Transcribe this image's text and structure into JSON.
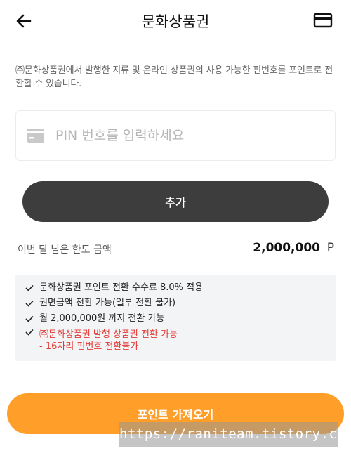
{
  "header": {
    "title": "문화상품권",
    "back_icon": "arrow-left-icon",
    "card_icon": "credit-card-icon"
  },
  "description": "㈜문화상품권에서 발행한 지류 및 온라인 상품권의 사용 가능한 핀번호를 포인트로 전환할 수 있습니다.",
  "pin_input": {
    "value": "",
    "placeholder": "PIN 번호를 입력하세요",
    "icon": "credit-card-icon"
  },
  "add_button": {
    "label": "추가"
  },
  "limit": {
    "label": "이번 달 남은 한도 금액",
    "value": "2,000,000",
    "unit": "P"
  },
  "notices": [
    "문화상품권 포인트 전환 수수료 8.0% 적용",
    "권면금액 전환 가능(일부 전환 불가)",
    "월 2,000,000원 까지 전환 가능"
  ],
  "notice_red": {
    "line1": "㈜문화상품권 발행 상품권 전환 가능",
    "line2": "- 16자리 핀번호 전환불가"
  },
  "fetch_button": {
    "label": "포인트 가져오기"
  },
  "watermark": "https://raniteam.tistory.com",
  "colors": {
    "accent": "#ff9f2a",
    "dark_button": "#3d3d3d",
    "warning_text": "#e53935",
    "notice_bg": "#f3f4f6"
  }
}
